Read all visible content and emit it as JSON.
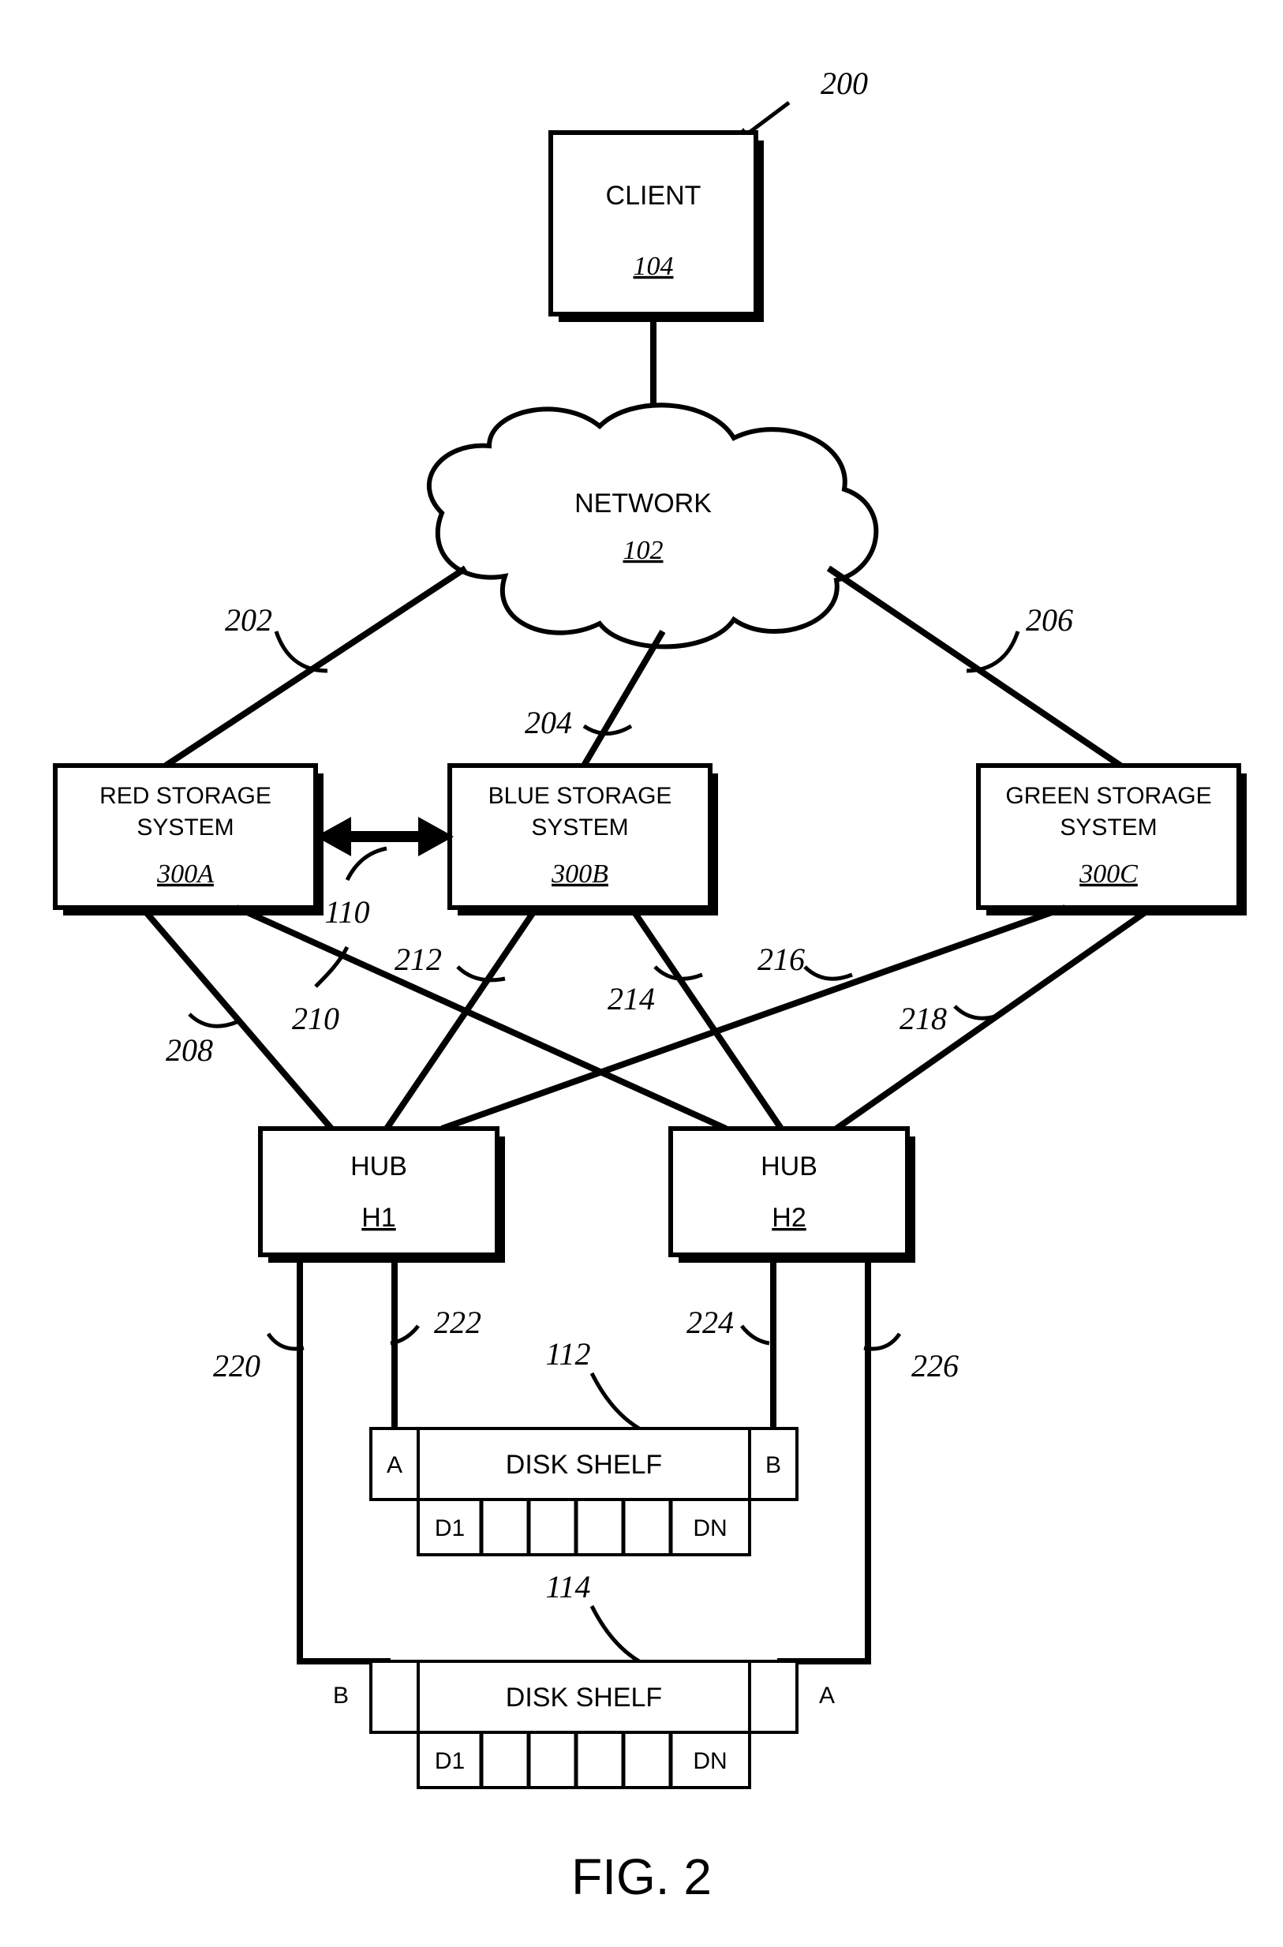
{
  "figure": {
    "caption": "FIG. 2",
    "callout_200": "200"
  },
  "client": {
    "title": "CLIENT",
    "id": "104"
  },
  "network": {
    "title": "NETWORK",
    "id": "102"
  },
  "storage": {
    "red": {
      "line1": "RED STORAGE",
      "line2": "SYSTEM",
      "id": "300A"
    },
    "blue": {
      "line1": "BLUE STORAGE",
      "line2": "SYSTEM",
      "id": "300B"
    },
    "green": {
      "line1": "GREEN  STORAGE",
      "line2": "SYSTEM",
      "id": "300C"
    }
  },
  "interconnect": {
    "id": "110"
  },
  "net_links": {
    "l202": "202",
    "l204": "204",
    "l206": "206"
  },
  "hub_links": {
    "l208": "208",
    "l210": "210",
    "l212": "212",
    "l214": "214",
    "l216": "216",
    "l218": "218"
  },
  "hubs": {
    "h1": {
      "title": "HUB",
      "id": "H1"
    },
    "h2": {
      "title": "HUB",
      "id": "H2"
    }
  },
  "shelf_links": {
    "l220": "220",
    "l222": "222",
    "l224": "224",
    "l226": "226"
  },
  "ports": {
    "a": "A",
    "b": "B"
  },
  "shelf1": {
    "title": "DISK SHELF",
    "id": "112",
    "d1": "D1",
    "dn": "DN"
  },
  "shelf2": {
    "title": "DISK SHELF",
    "id": "114",
    "d1": "D1",
    "dn": "DN"
  }
}
